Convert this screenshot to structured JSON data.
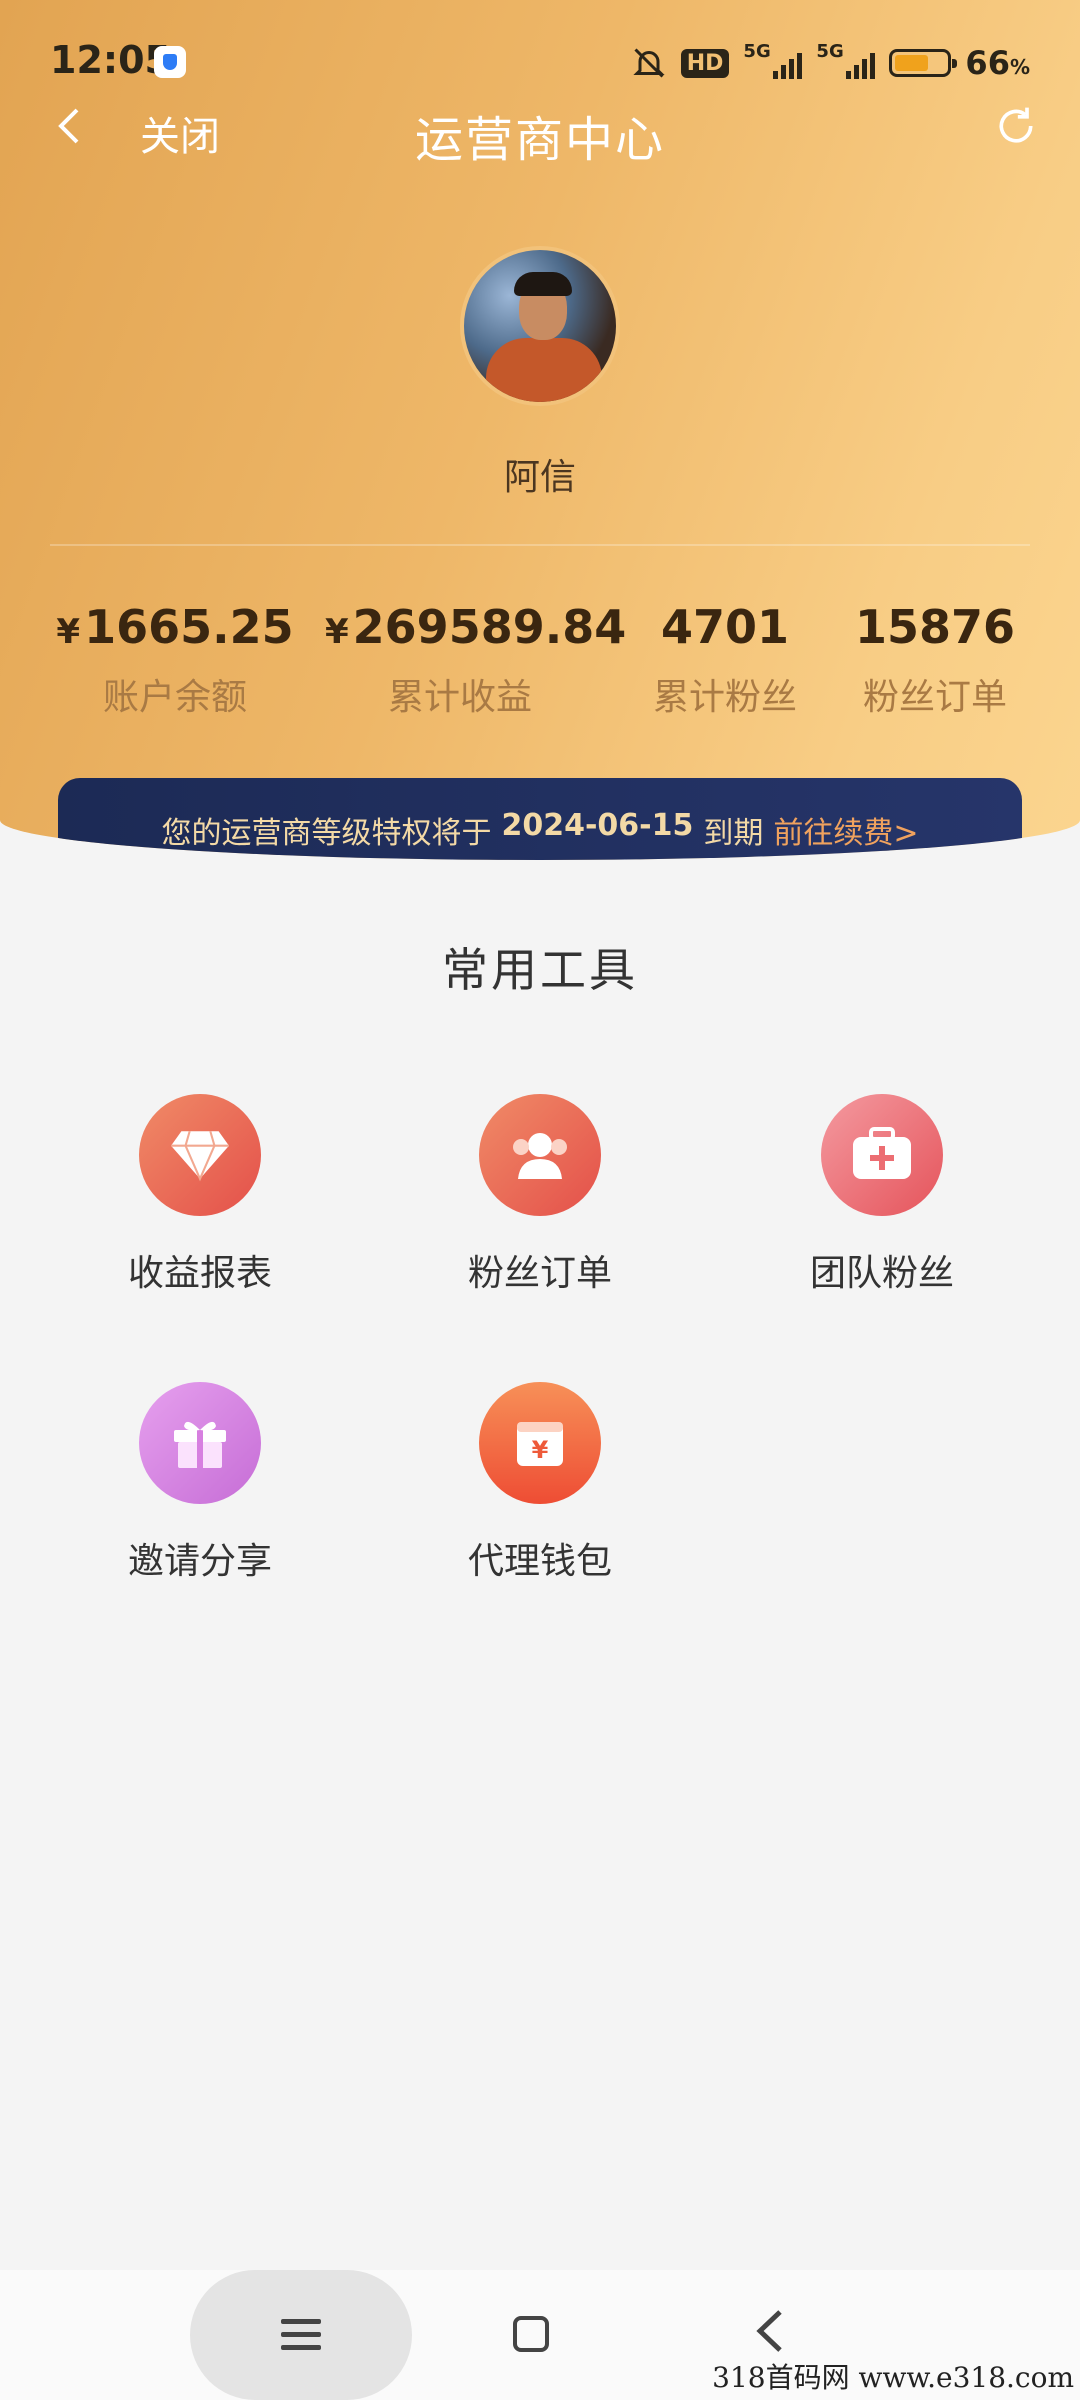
{
  "status_bar": {
    "time": "12:05",
    "hd": "HD",
    "sig1": "5G",
    "sig2": "5G",
    "battery_pct": "66",
    "battery_unit": "%",
    "battery_level": 0.66
  },
  "nav": {
    "back_icon": "chevron-left",
    "close_label": "关闭",
    "title": "运营商中心",
    "refresh_icon": "refresh"
  },
  "profile": {
    "name": "阿信"
  },
  "stats": [
    {
      "currency": "¥",
      "value": "1665.25",
      "label": "账户余额"
    },
    {
      "currency": "¥",
      "value": "269589.84",
      "label": "累计收益"
    },
    {
      "currency": "",
      "value": "4701",
      "label": "累计粉丝"
    },
    {
      "currency": "",
      "value": "15876",
      "label": "粉丝订单"
    }
  ],
  "banner": {
    "prefix": "您的运营商等级特权将于",
    "date": "2024-06-15",
    "suffix": "到期",
    "link": "前往续费>"
  },
  "tools": {
    "title": "常用工具",
    "items": [
      {
        "label": "收益报表",
        "icon": "diamond-icon",
        "color": "#e9664d"
      },
      {
        "label": "粉丝订单",
        "icon": "users-icon",
        "color": "#e9664d"
      },
      {
        "label": "团队粉丝",
        "icon": "kit-icon",
        "color": "#ec6d72"
      },
      {
        "label": "邀请分享",
        "icon": "gift-icon",
        "color": "#d77fe0"
      },
      {
        "label": "代理钱包",
        "icon": "wallet-icon",
        "color": "#f26a3d"
      }
    ]
  },
  "system_nav": {
    "menu": "≡",
    "back": "<"
  },
  "watermark": "318首码网  www.e318.com"
}
